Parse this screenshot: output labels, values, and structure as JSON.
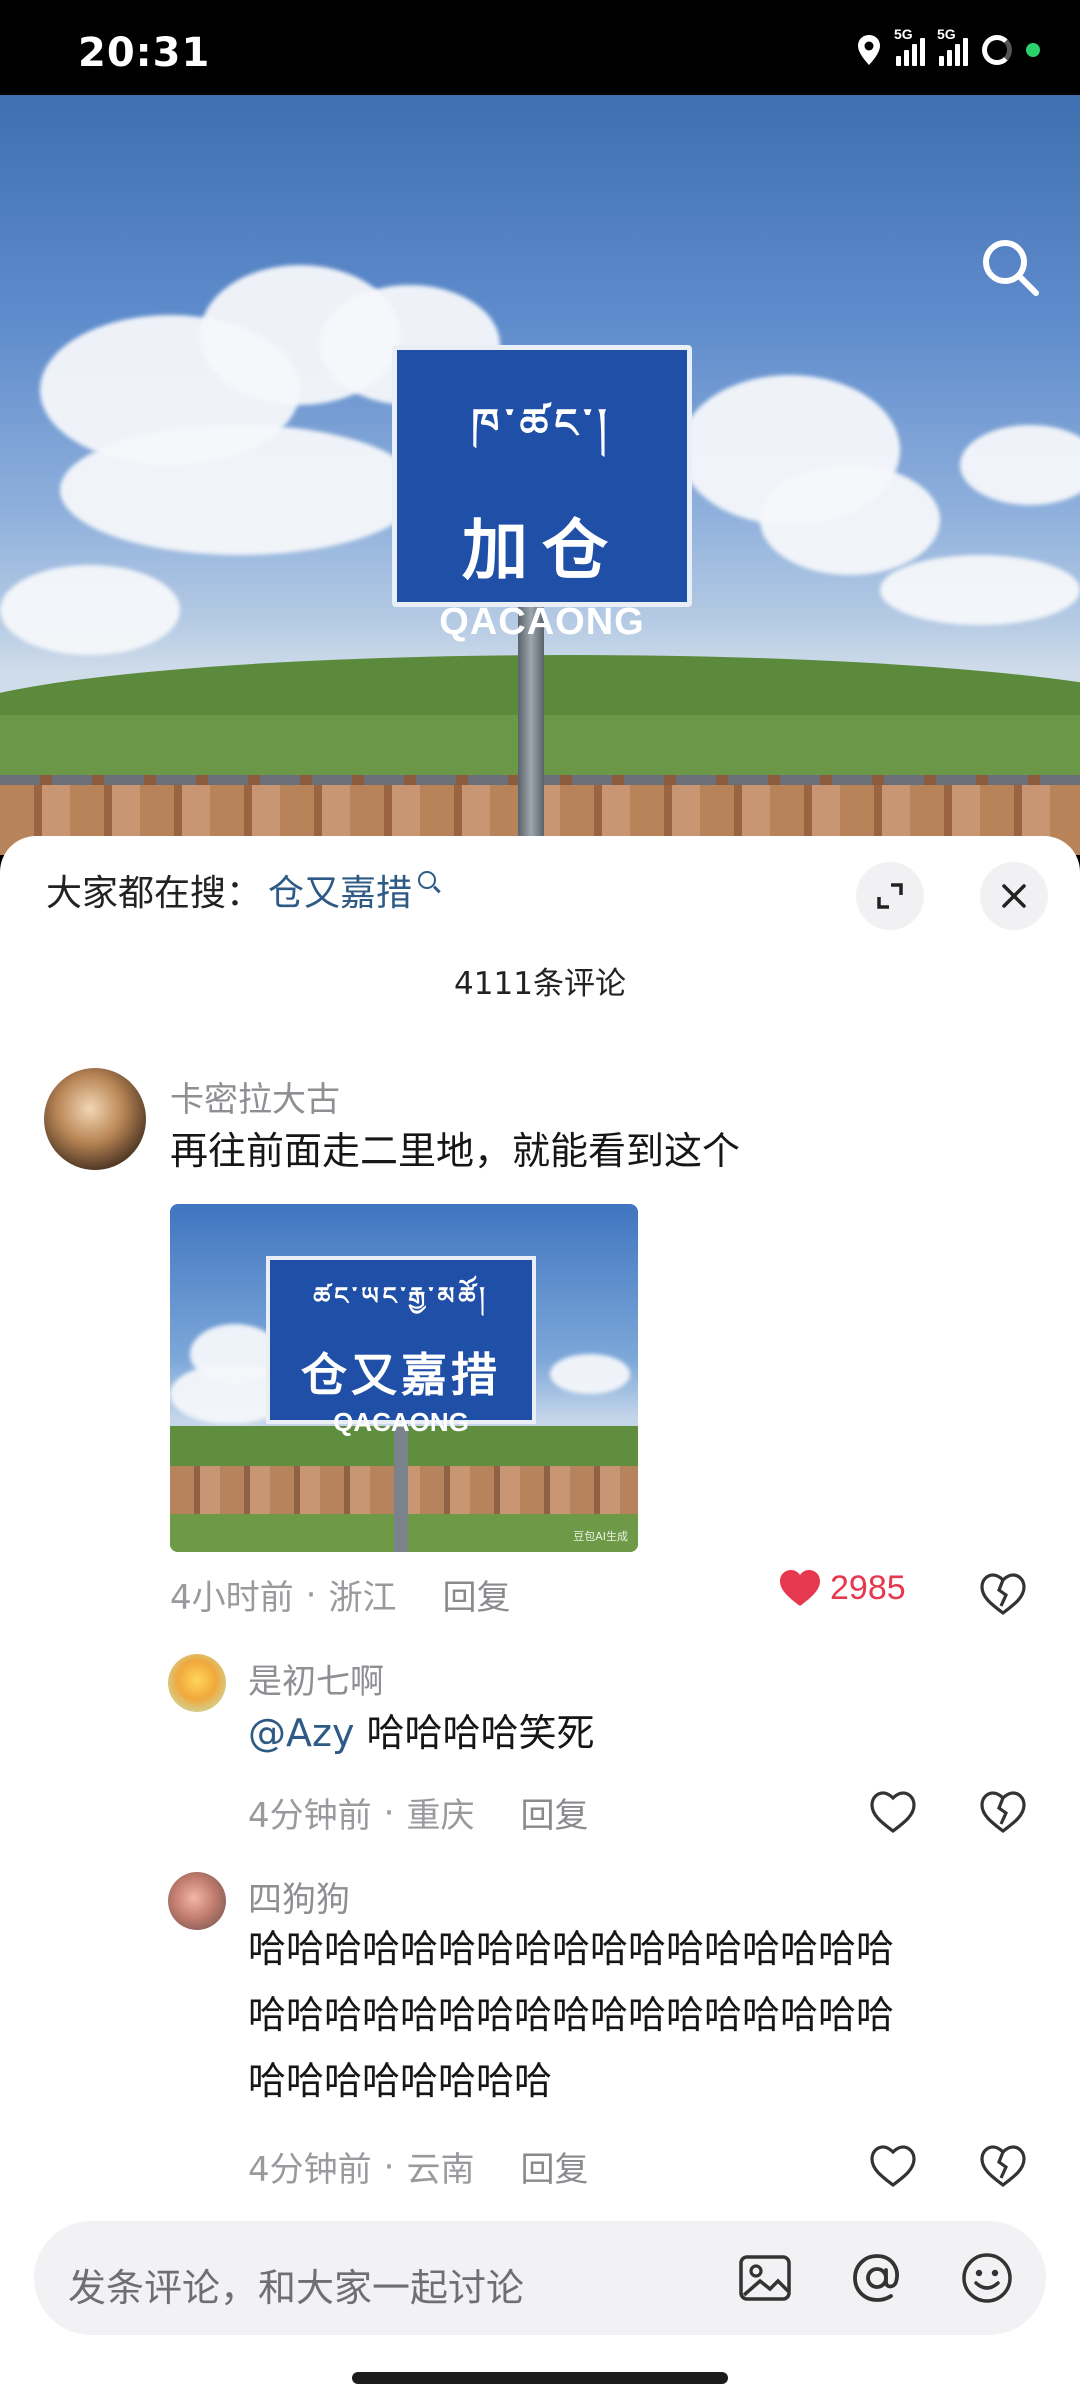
{
  "status_bar": {
    "time": "20:31",
    "signal1_label": "5G",
    "signal2_label": "5G"
  },
  "photo": {
    "sign_tibetan": "ཁ་ཚང་།",
    "sign_chinese": "加仓",
    "sign_english": "QACAONG"
  },
  "panel": {
    "hot_search_prefix": "大家都在搜：",
    "hot_search_keyword": "仓又嘉措",
    "comment_count": "4111条评论"
  },
  "comments": [
    {
      "username": "卡密拉大古",
      "text": "再往前面走二里地，就能看到这个",
      "image": {
        "sign_tibetan": "ཚང་ཡང་རྒྱ་མཚོ།",
        "sign_chinese": "仓又嘉措",
        "sign_english": "QACAONG",
        "watermark": "豆包AI生成"
      },
      "time": "4小时前",
      "location": "浙江",
      "reply_label": "回复",
      "like_count": "2985",
      "liked": true
    }
  ],
  "replies": [
    {
      "username": "是初七啊",
      "mention": "@Azy",
      "text": " 哈哈哈哈笑死",
      "time": "4分钟前",
      "location": "重庆",
      "reply_label": "回复"
    },
    {
      "username": "四狗狗",
      "text_line1": "哈哈哈哈哈哈哈哈哈哈哈哈哈哈哈哈哈",
      "text_line2": "哈哈哈哈哈哈哈哈哈哈哈哈哈哈哈哈哈",
      "text_line3": "哈哈哈哈哈哈哈哈",
      "time": "4分钟前",
      "location": "云南",
      "reply_label": "回复"
    }
  ],
  "input": {
    "placeholder": "发条评论，和大家一起讨论"
  },
  "colors": {
    "accent_link": "#2e5a86",
    "like_red": "#e6394f",
    "sign_blue": "#1f4fa6"
  },
  "icons": [
    "search-icon",
    "expand-icon",
    "close-icon",
    "heart-icon",
    "dislike-icon",
    "image-icon",
    "at-icon",
    "emoji-icon"
  ]
}
